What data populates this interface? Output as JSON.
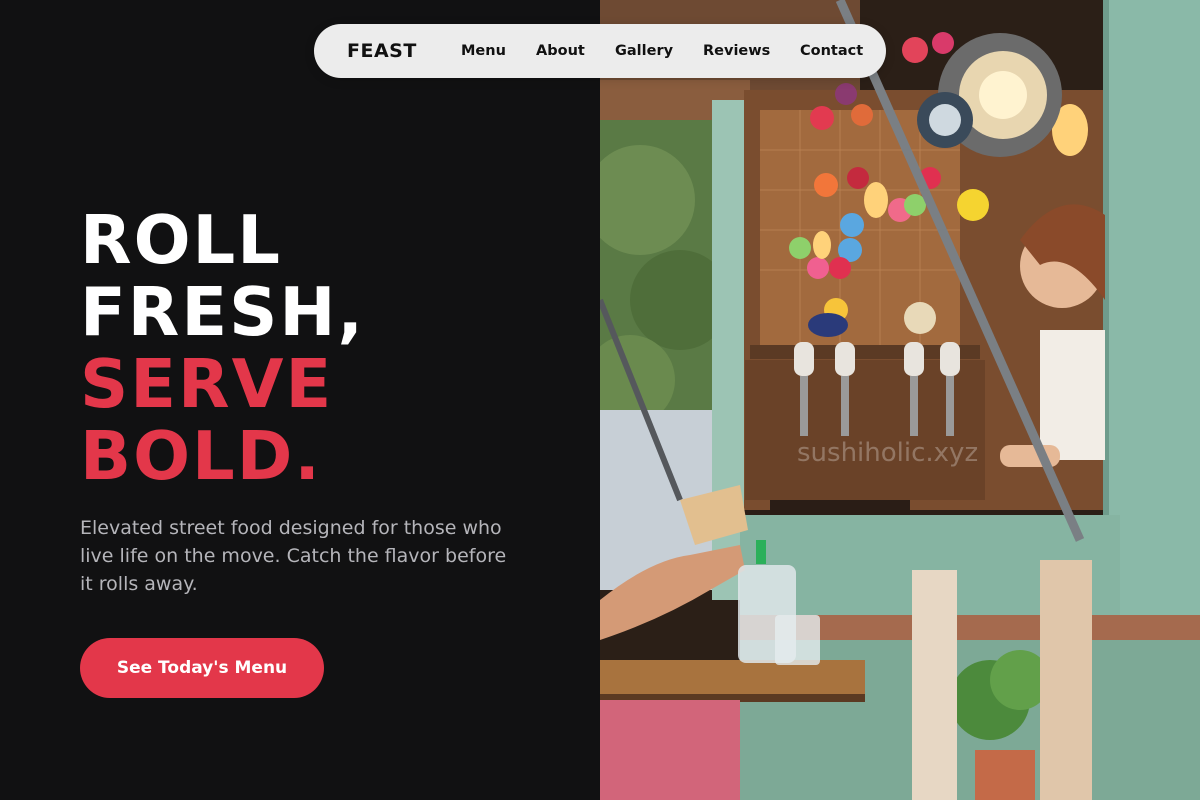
{
  "nav": {
    "brand": "FEAST",
    "items": [
      {
        "label": "Menu"
      },
      {
        "label": "About"
      },
      {
        "label": "Gallery"
      },
      {
        "label": "Reviews"
      },
      {
        "label": "Contact"
      }
    ]
  },
  "hero": {
    "title_lines": [
      "ROLL",
      "FRESH,",
      "SERVE",
      "BOLD."
    ],
    "subtitle": "Elevated street food designed for those who live life on the move. Catch the flavor before it rolls away.",
    "cta_label": "See Today's Menu"
  },
  "photo": {
    "watermark": "sushiholic.xyz"
  },
  "colors": {
    "background": "#111112",
    "accent": "#e3374a",
    "nav_bg": "#ececec"
  }
}
